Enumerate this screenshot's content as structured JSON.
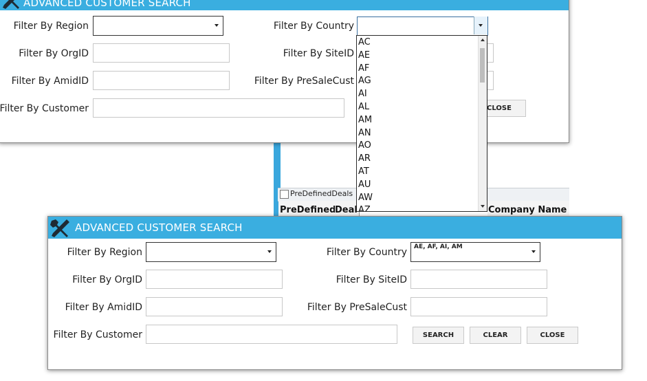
{
  "background": {
    "predefined_tab_label": "PreDefinedDeals",
    "column_headers": [
      "PreDefined",
      "Deal",
      "Company Name"
    ]
  },
  "top_dialog": {
    "title": "ADVANCED CUSTOMER SEARCH",
    "labels": {
      "region": "Filter By Region",
      "country": "Filter By Country",
      "orgid": "Filter By OrgID",
      "siteid": "Filter By SiteID",
      "amidid": "Filter By AmidID",
      "presalecust": "Filter By PreSaleCust",
      "customer": "Filter By Customer"
    },
    "close_label": "CLOSE",
    "country_options": [
      "AC",
      "AE",
      "AF",
      "AG",
      "AI",
      "AL",
      "AM",
      "AN",
      "AO",
      "AR",
      "AT",
      "AU",
      "AW",
      "AZ"
    ]
  },
  "bottom_dialog": {
    "title": "ADVANCED CUSTOMER SEARCH",
    "labels": {
      "region": "Filter By Region",
      "country": "Filter By Country",
      "orgid": "Filter By OrgID",
      "siteid": "Filter By SiteID",
      "amidid": "Filter By AmidID",
      "presalecust": "Filter By PreSaleCust",
      "customer": "Filter By Customer"
    },
    "country_value": "AE, AF, AI, AM",
    "buttons": {
      "search": "SEARCH",
      "clear": "CLEAR",
      "close": "CLOSE"
    }
  },
  "colors": {
    "titlebar": "#3aaee0",
    "dialog_bg": "#ffffff",
    "input_border": "#c7c7c7"
  }
}
